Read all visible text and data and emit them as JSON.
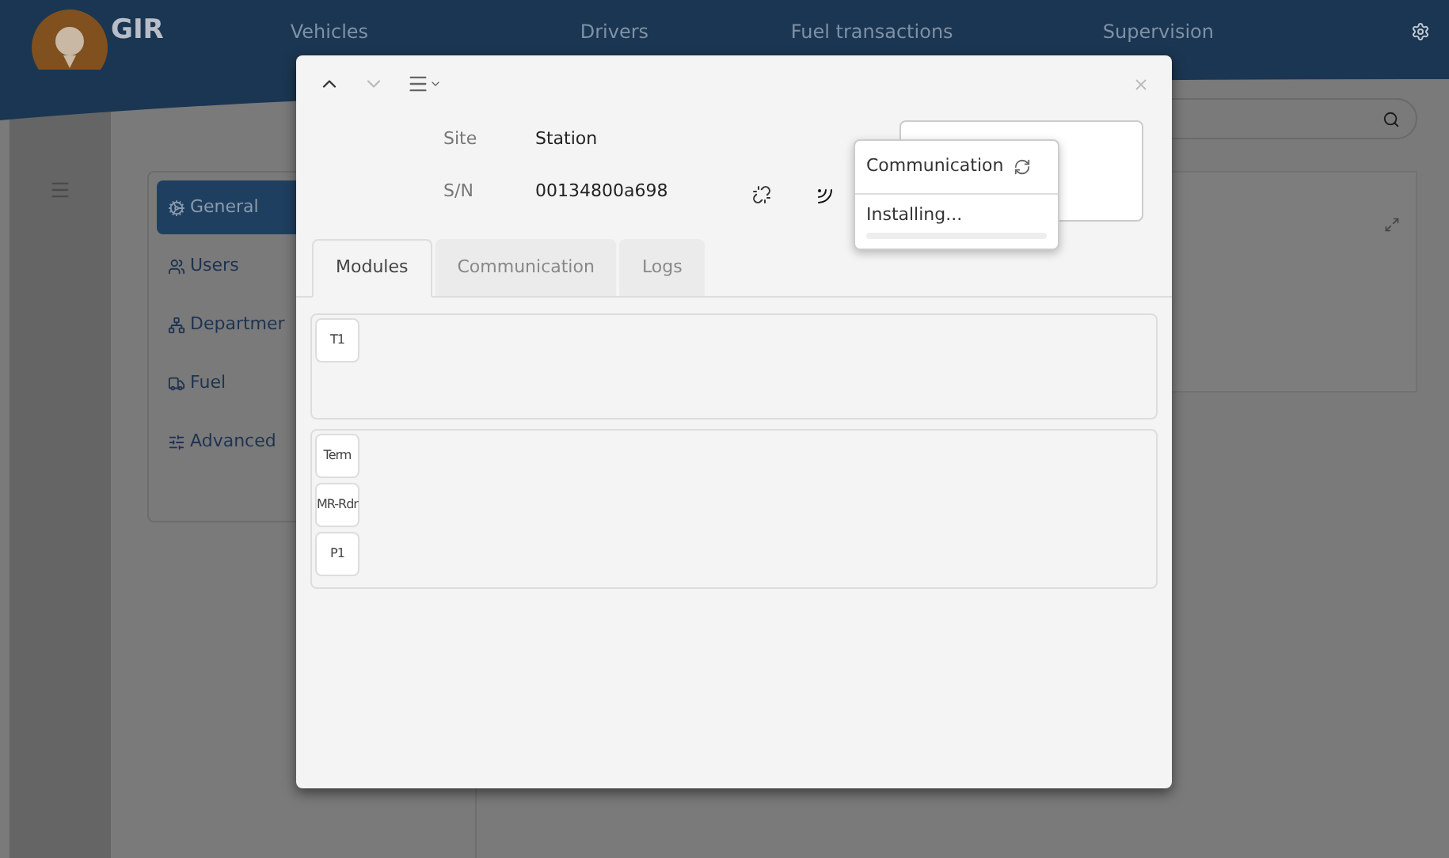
{
  "header": {
    "logo": "GIR",
    "nav": [
      {
        "label": "Vehicles"
      },
      {
        "label": "Drivers"
      },
      {
        "label": "Fuel transactions"
      },
      {
        "label": "Supervision"
      }
    ]
  },
  "sidebar": {
    "items": [
      {
        "label": "General",
        "selected": true
      },
      {
        "label": "Users",
        "selected": false
      },
      {
        "label": "Departmer",
        "selected": false
      },
      {
        "label": "Fuel",
        "selected": false
      },
      {
        "label": "Advanced",
        "selected": false
      }
    ]
  },
  "dialog": {
    "info": [
      {
        "label": "Site",
        "value": "Station"
      },
      {
        "label": "S/N",
        "value": "00134800a698"
      }
    ],
    "popover": {
      "title": "Communication",
      "status": "Installing..."
    },
    "tabs": [
      {
        "label": "Modules",
        "selected": true
      },
      {
        "label": "Communication",
        "selected": false
      },
      {
        "label": "Logs",
        "selected": false
      }
    ],
    "groups": [
      {
        "modules": [
          "T1"
        ]
      },
      {
        "modules": [
          "Term",
          "MR-Rdr",
          "P1"
        ]
      }
    ]
  }
}
